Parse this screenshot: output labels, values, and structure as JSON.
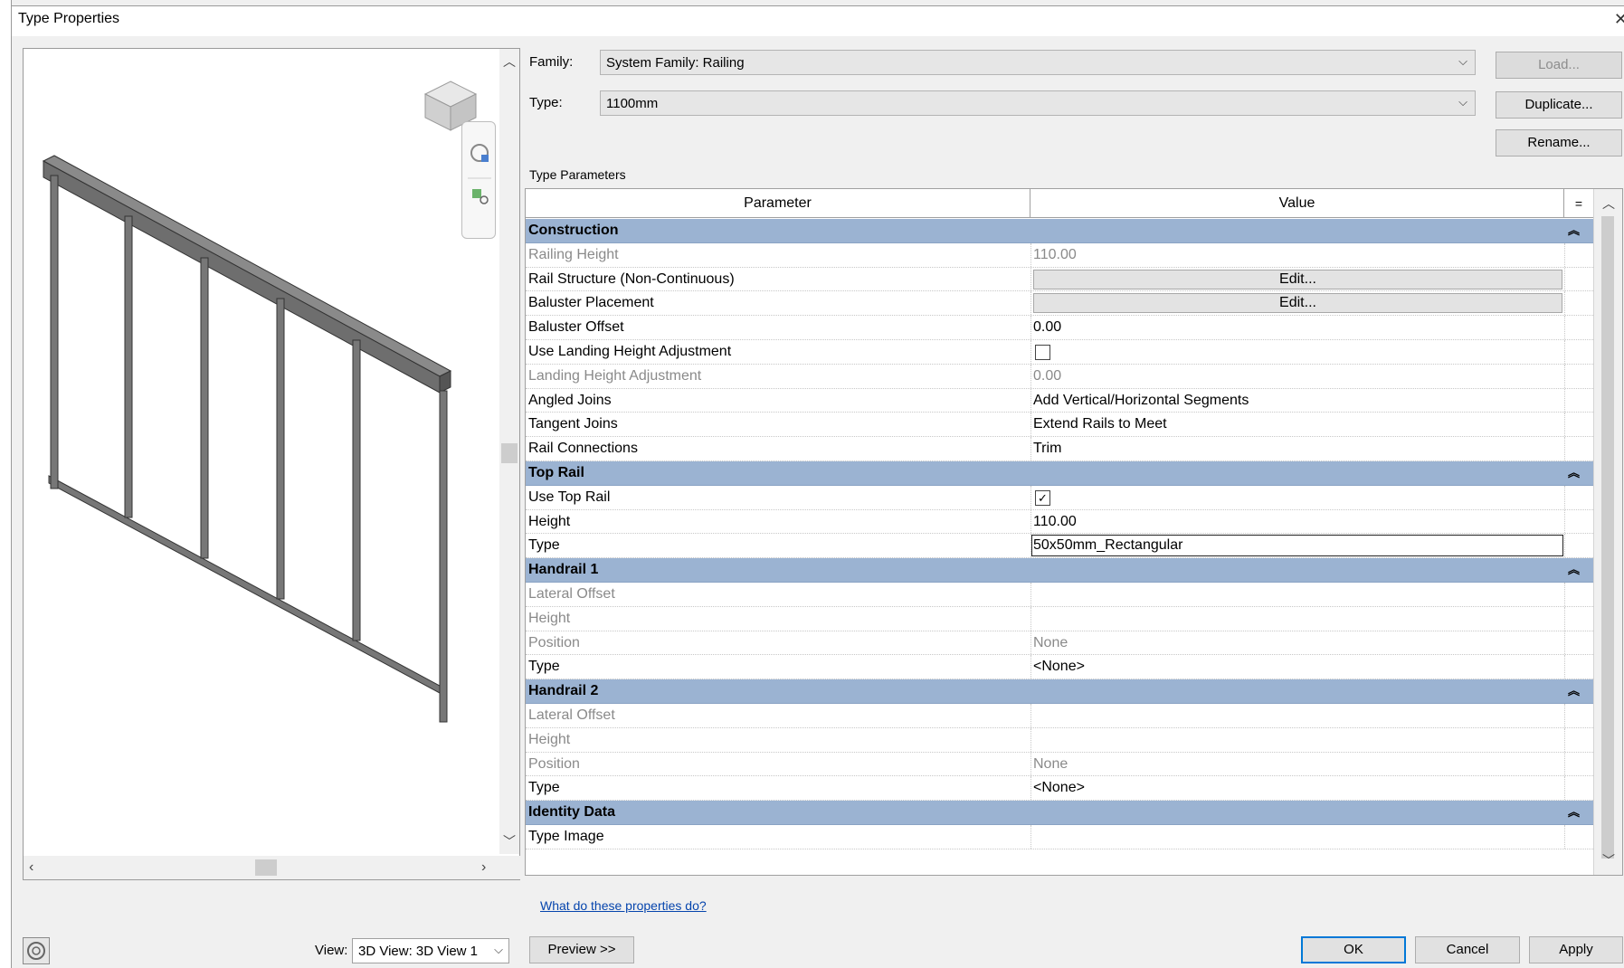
{
  "window": {
    "title": "Type Properties",
    "close_glyph": "✕"
  },
  "top": {
    "family_label": "Family:",
    "family_value": "System Family: Railing",
    "type_label": "Type:",
    "type_value": "1100mm",
    "load_label": "Load...",
    "duplicate_label": "Duplicate...",
    "rename_label": "Rename...",
    "section_label": "Type Parameters"
  },
  "grid": {
    "col_parameter": "Parameter",
    "col_value": "Value",
    "col_eq": "=",
    "groups": [
      {
        "name": "Construction",
        "rows": [
          {
            "p": "Railing Height",
            "v": "110.00",
            "dim": true
          },
          {
            "p": "Rail Structure (Non-Continuous)",
            "v": "Edit...",
            "kind": "button"
          },
          {
            "p": "Baluster Placement",
            "v": "Edit...",
            "kind": "button"
          },
          {
            "p": "Baluster Offset",
            "v": "0.00"
          },
          {
            "p": "Use Landing Height Adjustment",
            "v": "",
            "kind": "checkbox",
            "checked": false
          },
          {
            "p": "Landing Height Adjustment",
            "v": "0.00",
            "dim": true
          },
          {
            "p": "Angled Joins",
            "v": "Add Vertical/Horizontal Segments"
          },
          {
            "p": "Tangent Joins",
            "v": "Extend Rails to Meet"
          },
          {
            "p": "Rail Connections",
            "v": "Trim"
          }
        ]
      },
      {
        "name": "Top Rail",
        "rows": [
          {
            "p": "Use Top Rail",
            "v": "✓",
            "kind": "checkbox",
            "checked": true
          },
          {
            "p": "Height",
            "v": "110.00"
          },
          {
            "p": "Type",
            "v": "50x50mm_Rectangular",
            "kind": "input"
          }
        ]
      },
      {
        "name": "Handrail 1",
        "rows": [
          {
            "p": "Lateral Offset",
            "v": "",
            "dim": true
          },
          {
            "p": "Height",
            "v": "",
            "dim": true
          },
          {
            "p": "Position",
            "v": "None",
            "dim": true
          },
          {
            "p": "Type",
            "v": "<None>"
          }
        ]
      },
      {
        "name": "Handrail 2",
        "rows": [
          {
            "p": "Lateral Offset",
            "v": "",
            "dim": true
          },
          {
            "p": "Height",
            "v": "",
            "dim": true
          },
          {
            "p": "Position",
            "v": "None",
            "dim": true
          },
          {
            "p": "Type",
            "v": "<None>"
          }
        ]
      },
      {
        "name": "Identity Data",
        "rows": [
          {
            "p": "Type Image",
            "v": ""
          }
        ]
      }
    ]
  },
  "bottom": {
    "help_link": "What do these properties do?",
    "view_label": "View:",
    "view_value": "3D View: 3D View 1",
    "preview_label": "Preview >>",
    "ok_label": "OK",
    "cancel_label": "Cancel",
    "apply_label": "Apply"
  },
  "colors": {
    "group_header": "#9bb3d2",
    "link": "#0645ad",
    "ok_border": "#0078d7"
  }
}
